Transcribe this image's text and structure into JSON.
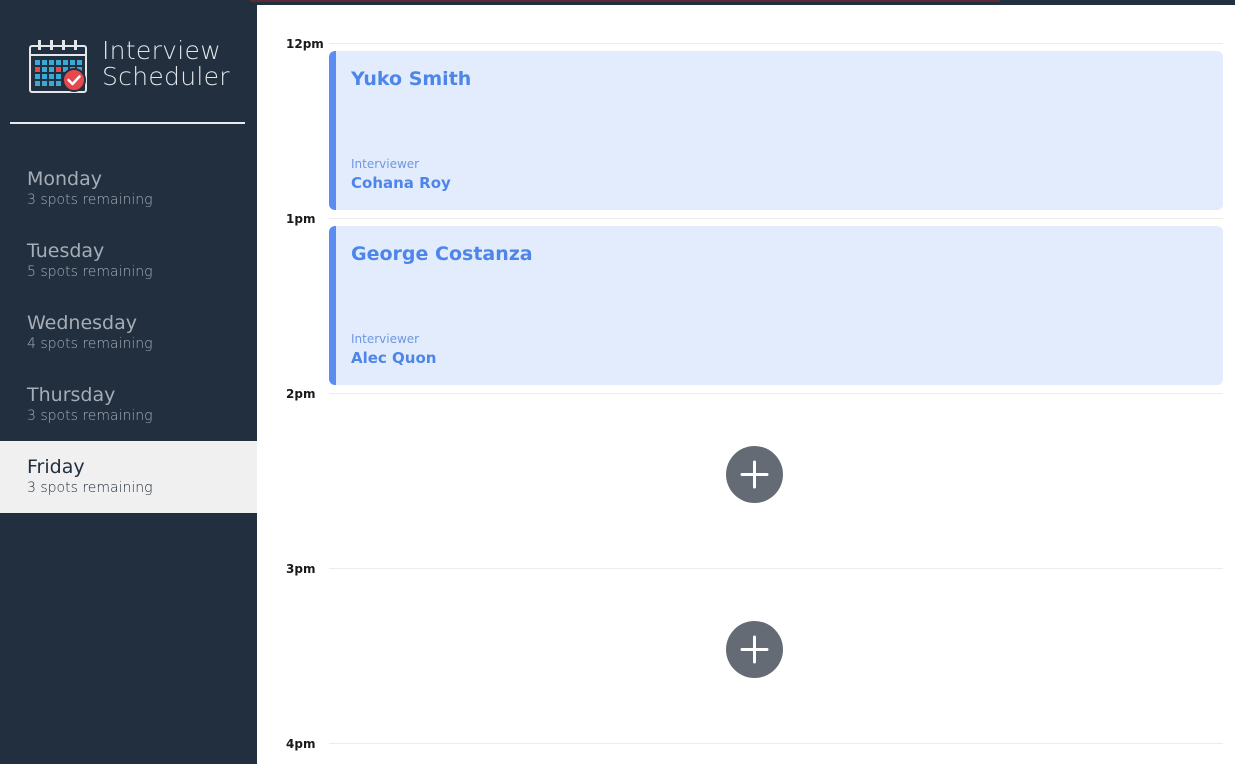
{
  "app": {
    "title_line1": "Interview",
    "title_line2": "Scheduler",
    "logo_icon": "calendar-check-icon"
  },
  "sidebar": {
    "days": [
      {
        "name": "Monday",
        "spots": "3 spots remaining",
        "selected": false
      },
      {
        "name": "Tuesday",
        "spots": "5 spots remaining",
        "selected": false
      },
      {
        "name": "Wednesday",
        "spots": "4 spots remaining",
        "selected": false
      },
      {
        "name": "Thursday",
        "spots": "3 spots remaining",
        "selected": false
      },
      {
        "name": "Friday",
        "spots": "3 spots remaining",
        "selected": true
      }
    ]
  },
  "schedule": {
    "slots": [
      {
        "time": "12pm",
        "student": "Yuko Smith",
        "interviewer_label": "Interviewer",
        "interviewer": "Cohana Roy"
      },
      {
        "time": "1pm",
        "student": "George Costanza",
        "interviewer_label": "Interviewer",
        "interviewer": "Alec Quon"
      },
      {
        "time": "2pm",
        "add_icon": "plus-icon"
      },
      {
        "time": "3pm",
        "add_icon": "plus-icon"
      },
      {
        "time": "4pm"
      }
    ]
  },
  "colors": {
    "sidebar_bg": "#222f3e",
    "selected_day_bg": "#f0f0f0",
    "appointment_bg": "#e2ecfd",
    "appointment_accent": "#5a8def",
    "add_button": "#646b74"
  }
}
